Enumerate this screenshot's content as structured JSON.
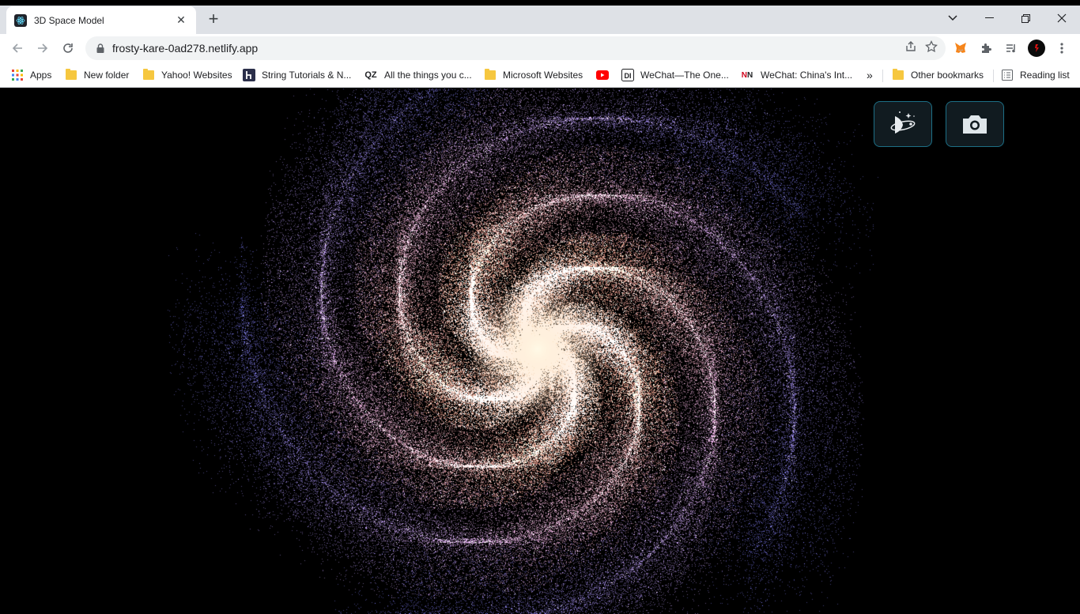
{
  "browser": {
    "tab": {
      "title": "3D Space Model",
      "favicon": "react-icon"
    },
    "url": "frosty-kare-0ad278.netlify.app",
    "bookmarks": [
      {
        "label": "Apps",
        "icon": "apps-grid-icon"
      },
      {
        "label": "New folder",
        "icon": "folder-icon"
      },
      {
        "label": "Yahoo! Websites",
        "icon": "folder-icon"
      },
      {
        "label": "String Tutorials & N...",
        "icon": "hashnode-icon"
      },
      {
        "label": "All the things you c...",
        "icon": "qz-icon"
      },
      {
        "label": "Microsoft Websites",
        "icon": "folder-icon"
      },
      {
        "label": "",
        "icon": "youtube-icon"
      },
      {
        "label": "WeChat—The One...",
        "icon": "di-icon"
      },
      {
        "label": "WeChat: China's Int...",
        "icon": "nn-icon"
      }
    ],
    "overflow_label": "»",
    "other_bookmarks": "Other bookmarks",
    "reading_list": "Reading list"
  },
  "app": {
    "controls": [
      {
        "name": "galaxy-view-button",
        "icon": "orbit-icon"
      },
      {
        "name": "screenshot-button",
        "icon": "camera-icon"
      }
    ],
    "galaxy_colors": {
      "core": "#fff6dc",
      "mid": "#e89a86",
      "outer": "#6b6bd8"
    }
  }
}
